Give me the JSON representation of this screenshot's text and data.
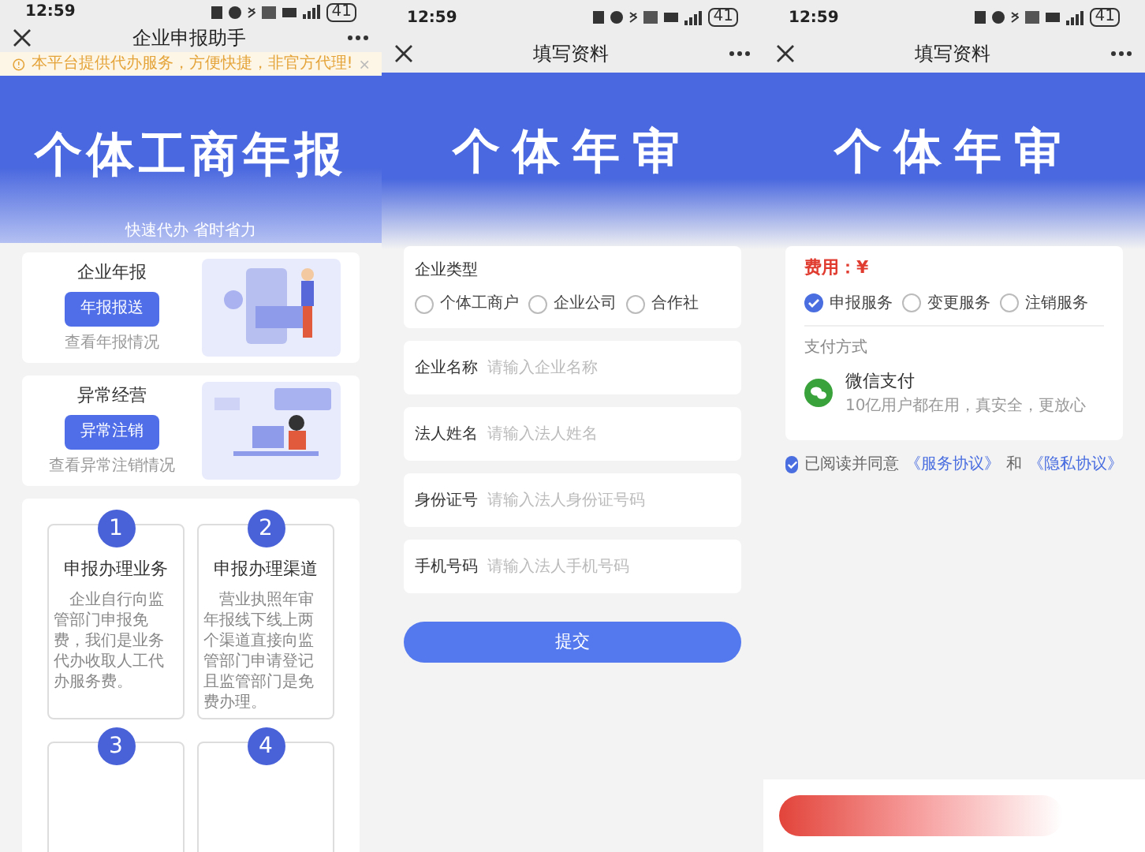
{
  "report_home": {
    "status_bar": {
      "time": "12:59",
      "battery": "41"
    },
    "nav": {
      "title": "企业申报助手"
    },
    "notice": {
      "text": "本平台提供代办服务，方便快捷，非官方代理!"
    },
    "hero": {
      "title": "个体工商年报",
      "subtitle": "快速代办 省时省力"
    },
    "service_cards": [
      {
        "heading": "企业年报",
        "button": "年报报送",
        "link": "查看年报情况",
        "kind": "report"
      },
      {
        "heading": "异常经营",
        "button": "异常注销",
        "link": "查看异常注销情况",
        "kind": "abnormal"
      }
    ],
    "steps": [
      {
        "number": "1",
        "title": "申报办理业务",
        "text": "企业自行向监管部门申报免费，我们是业务代办收取人工代办服务费。"
      },
      {
        "number": "2",
        "title": "申报办理渠道",
        "text": "营业执照年审年报线下线上两个渠道直接向监管部门申请登记且监管部门是免费办理。"
      },
      {
        "number": "3"
      },
      {
        "number": "4"
      }
    ]
  },
  "form_page": {
    "status_bar": {
      "time": "12:59",
      "battery": "41"
    },
    "nav": {
      "title": "填写资料"
    },
    "hero": {
      "title": "个体年审"
    },
    "company_type": {
      "label": "企业类型",
      "options": [
        {
          "label": "个体工商户",
          "selected": false
        },
        {
          "label": "企业公司",
          "selected": false
        },
        {
          "label": "合作社",
          "selected": false
        }
      ]
    },
    "fields": [
      {
        "label": "企业名称",
        "placeholder": "请输入企业名称"
      },
      {
        "label": "法人姓名",
        "placeholder": "请输入法人姓名"
      },
      {
        "label": "身份证号",
        "placeholder": "请输入法人身份证号码"
      },
      {
        "label": "手机号码",
        "placeholder": "请输入法人手机号码"
      }
    ],
    "submit": "提交"
  },
  "payment_page": {
    "status_bar": {
      "time": "12:59",
      "battery": "41"
    },
    "nav": {
      "title": "填写资料"
    },
    "hero": {
      "title": "个体年审"
    },
    "fee": "费用：¥",
    "services": [
      {
        "label": "申报服务",
        "selected": true
      },
      {
        "label": "变更服务",
        "selected": false
      },
      {
        "label": "注销服务",
        "selected": false
      }
    ],
    "payment_label": "支付方式",
    "payment": {
      "name": "微信支付",
      "note": "10亿用户都在用，真安全，更放心"
    },
    "agreement": {
      "checked": true,
      "text": "已阅读并同意",
      "link_1": "《服务协议》",
      "joiner": "和",
      "link_2": "《隐私协议》"
    }
  }
}
